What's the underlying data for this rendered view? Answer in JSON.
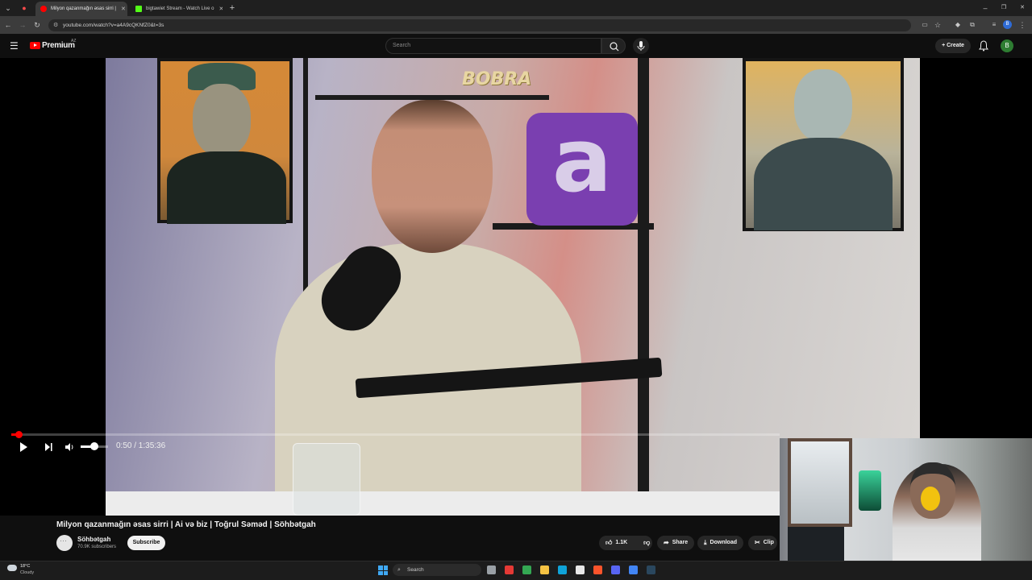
{
  "browser": {
    "tabs": [
      {
        "label": "Milyon qazanmağın əsas sirri |",
        "active": true,
        "favicon_color": "#ff0000"
      },
      {
        "label": "bigtawiet Stream - Watch Live o",
        "active": false,
        "favicon_color": "#53fc18"
      }
    ],
    "url": "youtube.com/watch?v=a4A9cQKNfZ0&t=3s",
    "window_controls": {
      "minimize": "–",
      "restore": "❐",
      "close": "✕"
    }
  },
  "youtube": {
    "logo_text": "Premium",
    "country_code": "AZ",
    "search_placeholder": "Search",
    "create_label": "Create",
    "avatar_letter": "B"
  },
  "video": {
    "scene_text": {
      "brand_sign": "BOBRA",
      "logo_letter": "a"
    },
    "current_time": "0:50",
    "duration": "1:35:36",
    "time_display": "0:50 / 1:35:36",
    "progress_fraction": 0.009,
    "volume_fraction": 0.5
  },
  "info": {
    "title": "Milyon qazanmağın əsas sirri | Ai və biz | Toğrul Səməd | Söhbətgah",
    "channel_name": "Söhbətgah",
    "subscribers": "70.9K subscribers",
    "subscribe_label": "Subscribe",
    "likes": "1.1K",
    "share_label": "Share",
    "download_label": "Download",
    "clip_label": "Clip"
  },
  "taskbar": {
    "temperature": "18°C",
    "condition": "Cloudy",
    "search_label": "Search",
    "apps": [
      {
        "name": "task-view",
        "color": "#9aa0a6"
      },
      {
        "name": "news",
        "color": "#e53935"
      },
      {
        "name": "chrome",
        "color": "#34a853"
      },
      {
        "name": "files",
        "color": "#f6c343"
      },
      {
        "name": "edge",
        "color": "#0fa3d8"
      },
      {
        "name": "store",
        "color": "#e8e8e8"
      },
      {
        "name": "brave",
        "color": "#fb542b"
      },
      {
        "name": "discord",
        "color": "#5865f2"
      },
      {
        "name": "chrome-active",
        "color": "#4285f4"
      },
      {
        "name": "steam",
        "color": "#2a475e"
      }
    ]
  },
  "colors": {
    "accent": "#ff0000",
    "background": "#0f0f0f",
    "pill": "#272727"
  }
}
